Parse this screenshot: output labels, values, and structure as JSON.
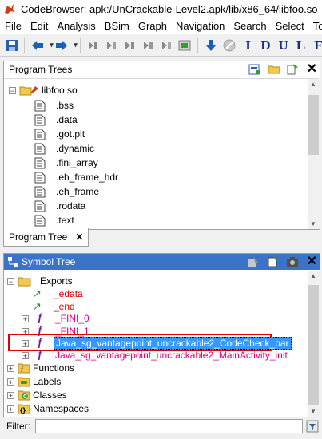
{
  "window": {
    "title": "CodeBrowser: apk:/UnCrackable-Level2.apk/lib/x86_64/libfoo.so"
  },
  "menu": [
    "File",
    "Edit",
    "Analysis",
    "BSim",
    "Graph",
    "Navigation",
    "Search",
    "Select",
    "Tools"
  ],
  "toolbar": {
    "letters": [
      "I",
      "D",
      "U",
      "L",
      "F"
    ]
  },
  "program_trees": {
    "title": "Program Trees",
    "root": "libfoo.so",
    "sections": [
      ".bss",
      ".data",
      ".got.plt",
      ".dynamic",
      ".fini_array",
      ".eh_frame_hdr",
      ".eh_frame",
      ".rodata",
      ".text"
    ],
    "tab_label": "Program Tree"
  },
  "symbol_tree": {
    "title": "Symbol Tree",
    "exports_label": "Exports",
    "exports": [
      "_edata",
      "_end",
      "_FINI_0",
      "_FINI_1",
      "Java_sg_vantagepoint_uncrackable2_CodeCheck_bar",
      "Java_sg_vantagepoint_uncrackable2_MainActivity_init"
    ],
    "groups": [
      "Functions",
      "Labels",
      "Classes",
      "Namespaces"
    ]
  },
  "filter": {
    "label": "Filter:",
    "value": ""
  },
  "colors": {
    "selection": "#3399ff",
    "highlight_box": "#e00000",
    "accent_magenta": "#e0008c"
  }
}
